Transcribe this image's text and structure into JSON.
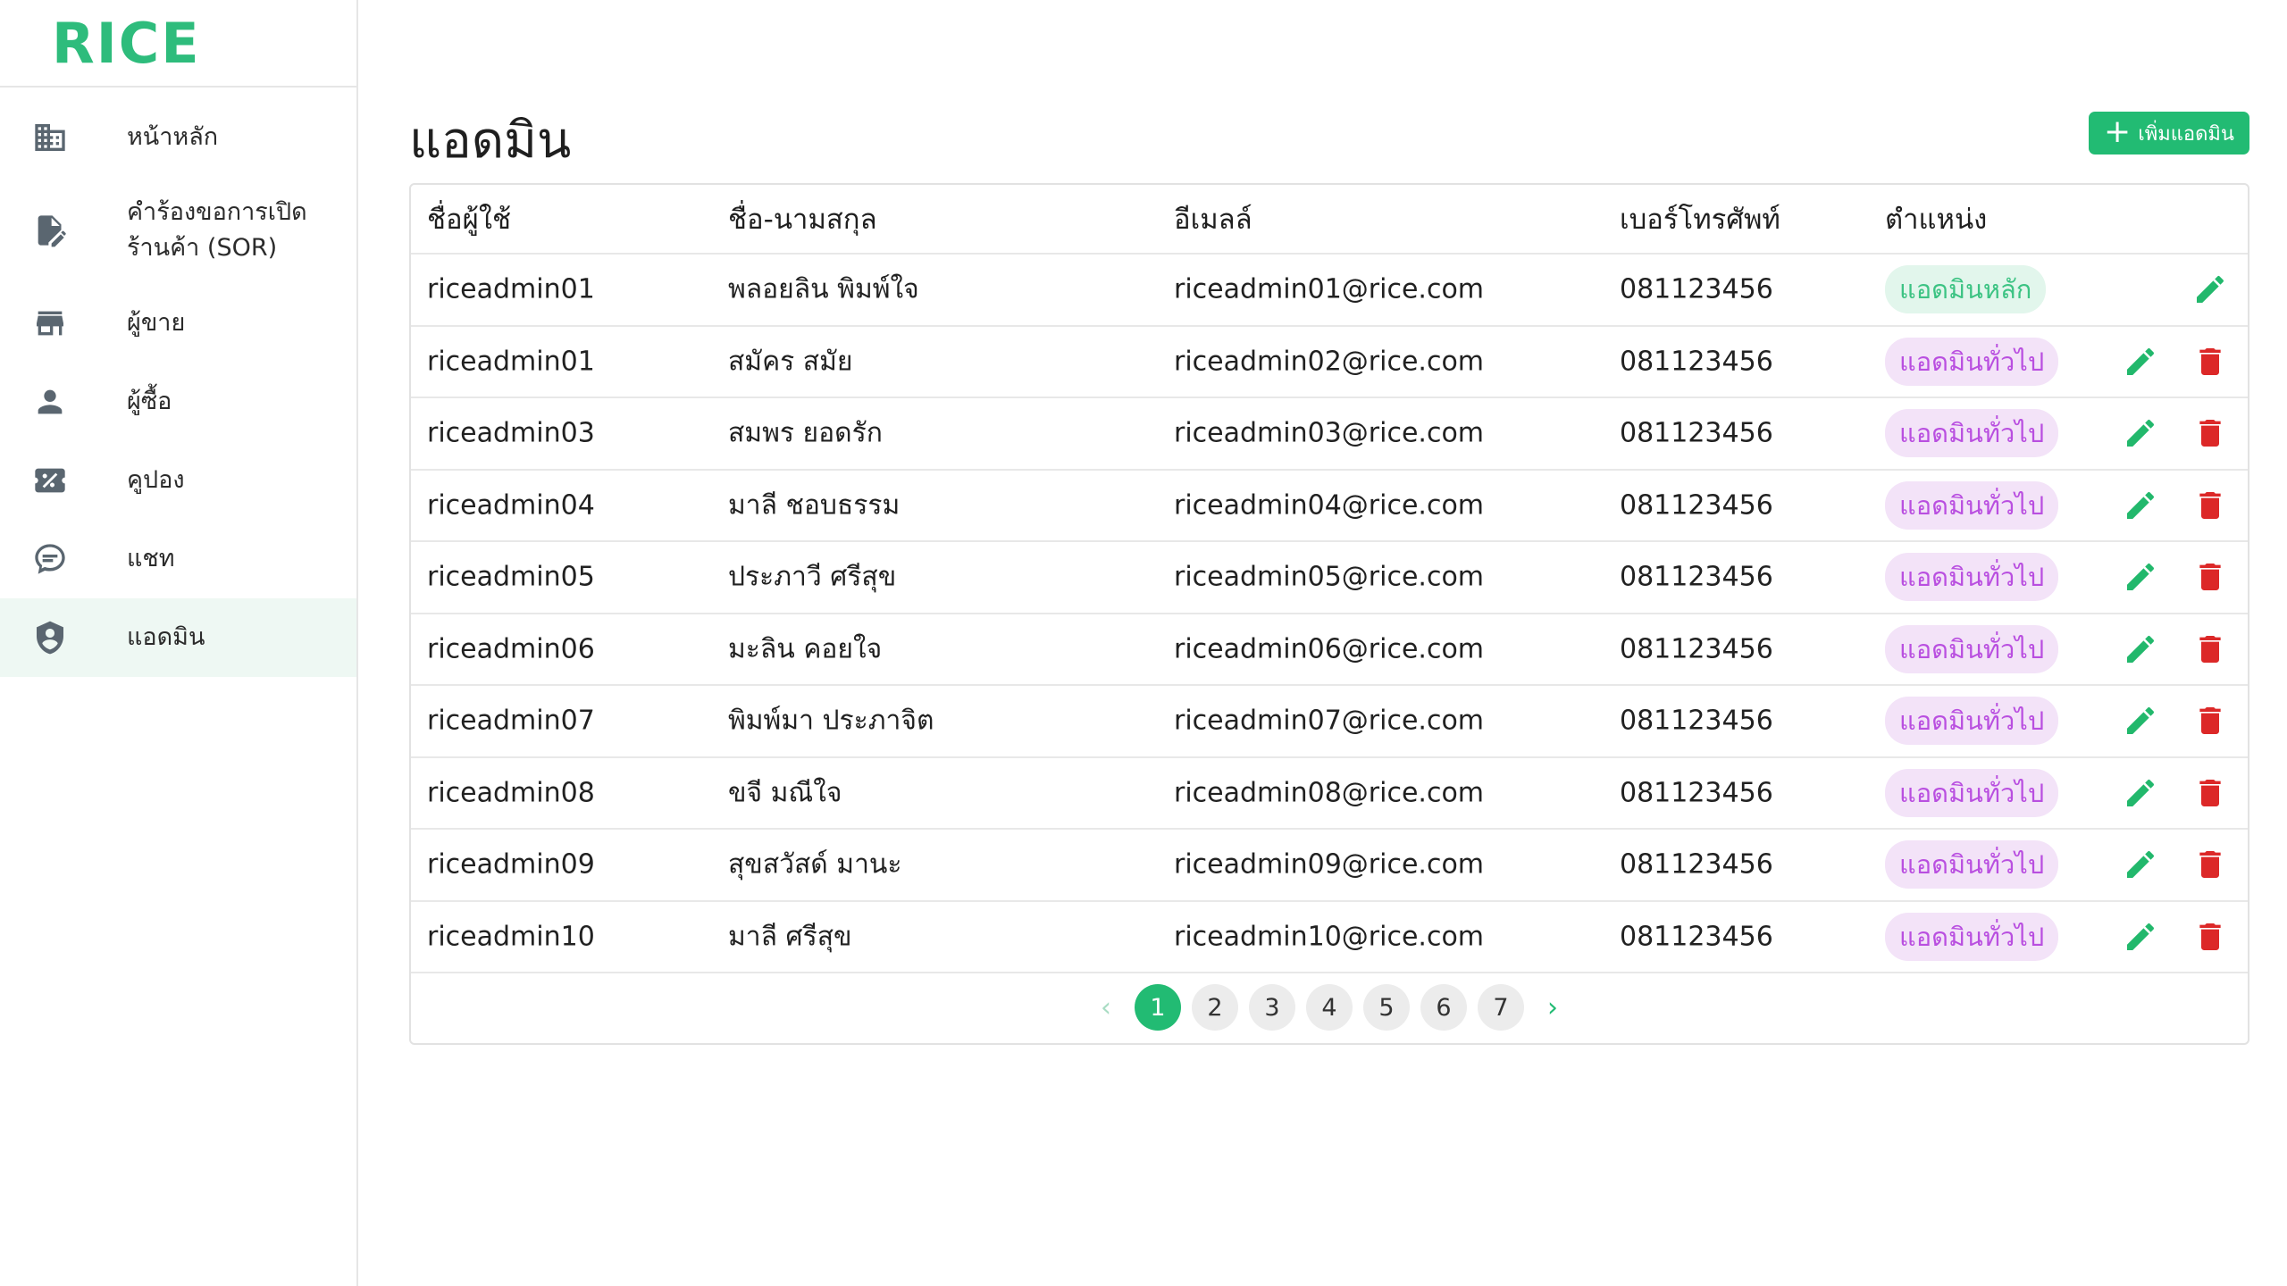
{
  "brand": {
    "logo_text": "RICE",
    "accent": "#22bb73"
  },
  "sidebar": {
    "items": [
      {
        "label": "หน้าหลัก",
        "icon": "building-icon"
      },
      {
        "label": "คำร้องขอการเปิดร้านค้า (SOR)",
        "icon": "edit-document-icon"
      },
      {
        "label": "ผู้ขาย",
        "icon": "store-icon"
      },
      {
        "label": "ผู้ซื้อ",
        "icon": "person-icon"
      },
      {
        "label": "คูปอง",
        "icon": "coupon-icon"
      },
      {
        "label": "แชท",
        "icon": "chat-icon"
      },
      {
        "label": "แอดมิน",
        "icon": "shield-user-icon",
        "active": true
      }
    ]
  },
  "page": {
    "title": "แอดมิน",
    "add_button_label": "เพิ่มแอดมิน"
  },
  "table": {
    "headers": {
      "username": "ชื่อผู้ใช้",
      "fullname": "ชื่อ-นามสกุล",
      "email": "อีเมลล์",
      "phone": "เบอร์โทรศัพท์",
      "role": "ตำแหน่ง"
    },
    "rows": [
      {
        "username": "riceadmin01",
        "fullname": "พลอยลิน พิมพ์ใจ",
        "email": "riceadmin01@rice.com",
        "phone": "081123456",
        "role": "แอดมินหลัก"
      },
      {
        "username": "riceadmin01",
        "fullname": "สมัคร สมัย",
        "email": "riceadmin02@rice.com",
        "phone": "081123456",
        "role": "แอดมินทั่วไป"
      },
      {
        "username": "riceadmin03",
        "fullname": "สมพร ยอดรัก",
        "email": "riceadmin03@rice.com",
        "phone": "081123456",
        "role": "แอดมินทั่วไป"
      },
      {
        "username": "riceadmin04",
        "fullname": "มาลี ชอบธรรม",
        "email": "riceadmin04@rice.com",
        "phone": "081123456",
        "role": "แอดมินทั่วไป"
      },
      {
        "username": "riceadmin05",
        "fullname": "ประภาวี ศรีสุข",
        "email": "riceadmin05@rice.com",
        "phone": "081123456",
        "role": "แอดมินทั่วไป"
      },
      {
        "username": "riceadmin06",
        "fullname": "มะลิน คอยใจ",
        "email": "riceadmin06@rice.com",
        "phone": "081123456",
        "role": "แอดมินทั่วไป"
      },
      {
        "username": "riceadmin07",
        "fullname": "พิมพ์มา ประภาจิต",
        "email": "riceadmin07@rice.com",
        "phone": "081123456",
        "role": "แอดมินทั่วไป"
      },
      {
        "username": "riceadmin08",
        "fullname": "ขจี มณีใจ",
        "email": "riceadmin08@rice.com",
        "phone": "081123456",
        "role": "แอดมินทั่วไป"
      },
      {
        "username": "riceadmin09",
        "fullname": "สุขสวัสด์ มานะ",
        "email": "riceadmin09@rice.com",
        "phone": "081123456",
        "role": "แอดมินทั่วไป"
      },
      {
        "username": "riceadmin10",
        "fullname": "มาลี ศรีสุข",
        "email": "riceadmin10@rice.com",
        "phone": "081123456",
        "role": "แอดมินทั่วไป"
      }
    ]
  },
  "pagination": {
    "pages": [
      "1",
      "2",
      "3",
      "4",
      "5",
      "6",
      "7"
    ],
    "current": "1",
    "prev_icon": "chevron-left-icon",
    "next_icon": "chevron-right-icon"
  }
}
